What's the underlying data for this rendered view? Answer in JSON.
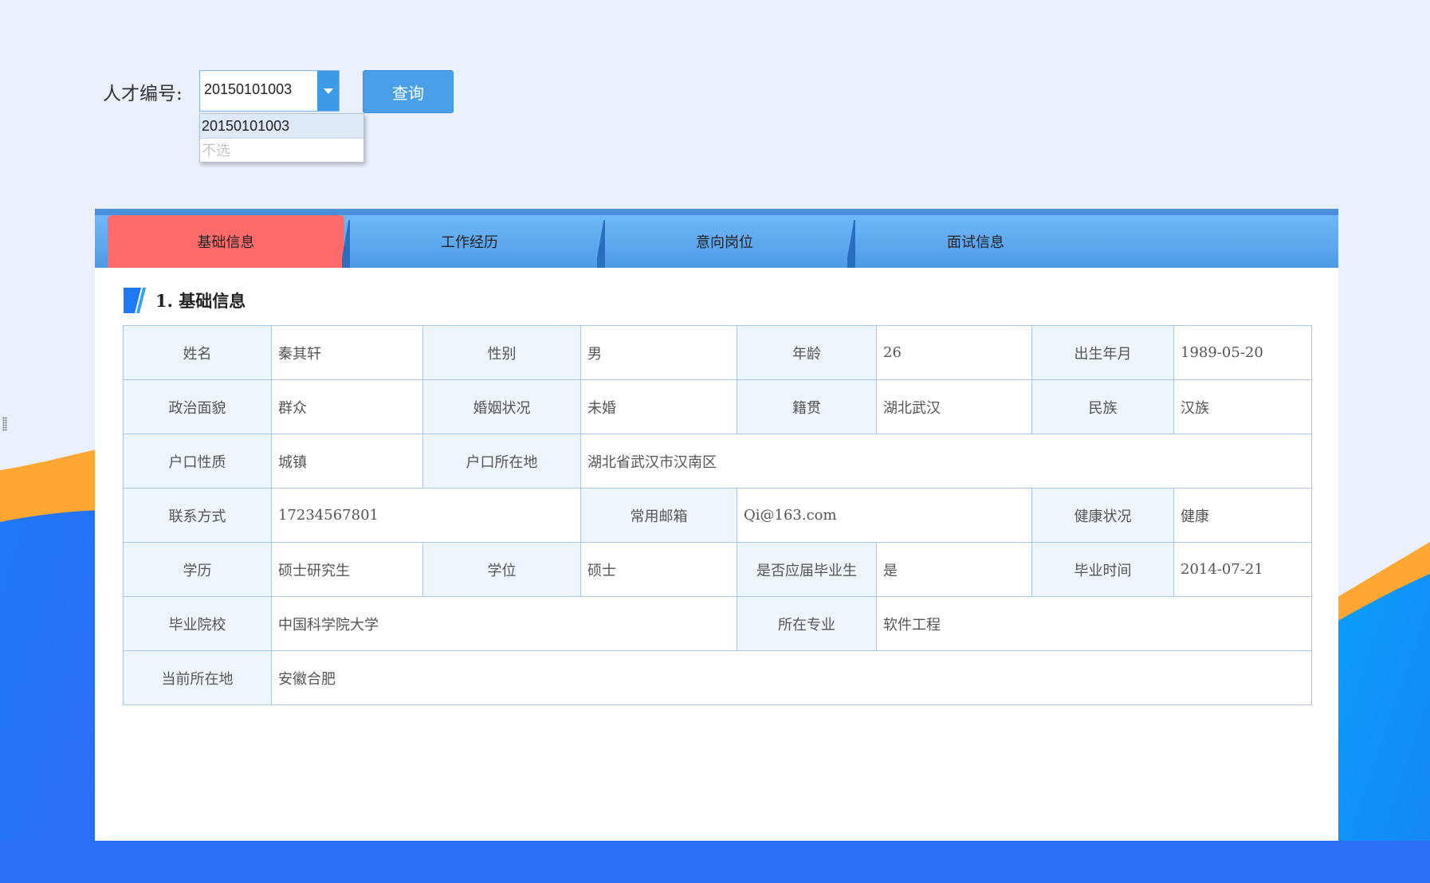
{
  "search": {
    "label": "人才编号:",
    "selected_value": "20150101003",
    "options": [
      "20150101003",
      "不选"
    ],
    "query_button": "查询"
  },
  "tabs": [
    "基础信息",
    "工作经历",
    "意向岗位",
    "面试信息"
  ],
  "active_tab": "基础信息",
  "section": {
    "title": "1. 基础信息"
  },
  "rows": [
    [
      {
        "label": "姓名",
        "value": "秦其轩"
      },
      {
        "label": "性别",
        "value": "男"
      },
      {
        "label": "年龄",
        "value": "26"
      },
      {
        "label": "出生年月",
        "value": "1989-05-20"
      }
    ],
    [
      {
        "label": "政治面貌",
        "value": "群众"
      },
      {
        "label": "婚姻状况",
        "value": "未婚"
      },
      {
        "label": "籍贯",
        "value": "湖北武汉"
      },
      {
        "label": "民族",
        "value": "汉族"
      }
    ],
    [
      {
        "label": "户口性质",
        "value": "城镇"
      },
      {
        "label": "户口所在地",
        "value": "湖北省武汉市汉南区"
      }
    ],
    [
      {
        "label": "联系方式",
        "value": "17234567801"
      },
      {
        "label": "常用邮箱",
        "value": "Qi@163.com"
      },
      {
        "label": "健康状况",
        "value": "健康"
      }
    ],
    [
      {
        "label": "学历",
        "value": "硕士研究生"
      },
      {
        "label": "学位",
        "value": "硕士"
      },
      {
        "label": "是否应届毕业生",
        "value": "是"
      },
      {
        "label": "毕业时间",
        "value": "2014-07-21"
      }
    ],
    [
      {
        "label": "毕业院校",
        "value": "中国科学院大学"
      },
      {
        "label": "所在专业",
        "value": "软件工程"
      }
    ],
    [
      {
        "label": "当前所在地",
        "value": "安徽合肥"
      }
    ]
  ],
  "colors": {
    "background": "#eaf1fc",
    "wave_orange": "#ffa733",
    "wave_blue": "#2a7ff5",
    "tab_bar": "#5aa6ef",
    "tab_active": "#ff6b6b",
    "button": "#4aa0e8",
    "label_cell": "#eff5fd",
    "border": "#a9c6ea"
  }
}
